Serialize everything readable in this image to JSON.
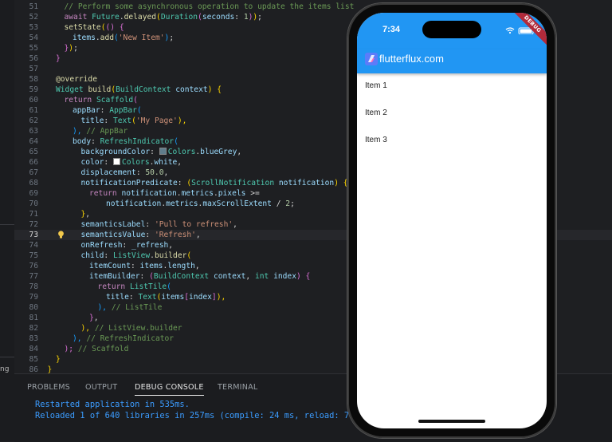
{
  "sidebar": {
    "fragment": "ng"
  },
  "editor": {
    "active_line": 73,
    "lines": [
      {
        "n": 51,
        "segs": [
          [
            "cm",
            "// Perform some asynchronous operation to update the items list"
          ]
        ],
        "indent": 10
      },
      {
        "n": 52,
        "segs": [
          [
            "kw",
            "await "
          ],
          [
            "ty",
            "Future"
          ],
          [
            "",
            "."
          ],
          [
            "fn",
            "delayed"
          ],
          [
            "br",
            "("
          ],
          [
            "ty",
            "Duration"
          ],
          [
            "br2",
            "("
          ],
          [
            "prop",
            "seconds"
          ],
          [
            "",
            ": "
          ],
          [
            "num",
            "1"
          ],
          [
            "br2",
            ")"
          ],
          [
            "br",
            ")"
          ],
          [
            "",
            ";"
          ]
        ],
        "indent": 10
      },
      {
        "n": 53,
        "segs": [
          [
            "fn",
            "setState"
          ],
          [
            "br",
            "("
          ],
          [
            "br2",
            "("
          ],
          [
            "br2",
            ")"
          ],
          [
            "",
            " "
          ],
          [
            "br2",
            "{"
          ]
        ],
        "indent": 10
      },
      {
        "n": 54,
        "segs": [
          [
            "prop",
            "items"
          ],
          [
            "",
            "."
          ],
          [
            "fn",
            "add"
          ],
          [
            "br3",
            "("
          ],
          [
            "str",
            "'New Item'"
          ],
          [
            "br3",
            ")"
          ],
          [
            "",
            ";"
          ]
        ],
        "indent": 20
      },
      {
        "n": 55,
        "segs": [
          [
            "br2",
            "}"
          ],
          [
            "br",
            ")"
          ],
          [
            "",
            ";"
          ]
        ],
        "indent": 10
      },
      {
        "n": 56,
        "segs": [
          [
            "br2",
            "}"
          ]
        ],
        "indent": 0
      },
      {
        "n": 57,
        "segs": [],
        "indent": 0
      },
      {
        "n": 58,
        "segs": [
          [
            "an",
            "@override"
          ]
        ],
        "indent": 0
      },
      {
        "n": 59,
        "segs": [
          [
            "ty",
            "Widget "
          ],
          [
            "fn",
            "build"
          ],
          [
            "br",
            "("
          ],
          [
            "ty",
            "BuildContext "
          ],
          [
            "prop",
            "context"
          ],
          [
            "br",
            ")"
          ],
          [
            "",
            " "
          ],
          [
            "br",
            "{"
          ]
        ],
        "indent": 0
      },
      {
        "n": 60,
        "segs": [
          [
            "kw",
            "return "
          ],
          [
            "ty",
            "Scaffold"
          ],
          [
            "br2",
            "("
          ]
        ],
        "indent": 10
      },
      {
        "n": 61,
        "segs": [
          [
            "prop",
            "appBar"
          ],
          [
            "",
            ": "
          ],
          [
            "ty",
            "AppBar"
          ],
          [
            "br3",
            "("
          ]
        ],
        "indent": 20
      },
      {
        "n": 62,
        "segs": [
          [
            "prop",
            "title"
          ],
          [
            "",
            ": "
          ],
          [
            "ty",
            "Text"
          ],
          [
            "br",
            "("
          ],
          [
            "str",
            "'My Page'"
          ],
          [
            "br",
            "),"
          ]
        ],
        "indent": 30
      },
      {
        "n": 63,
        "segs": [
          [
            "br3",
            "), "
          ],
          [
            "cm",
            "// AppBar"
          ]
        ],
        "indent": 20
      },
      {
        "n": 64,
        "segs": [
          [
            "prop",
            "body"
          ],
          [
            "",
            ": "
          ],
          [
            "ty",
            "RefreshIndicator"
          ],
          [
            "br3",
            "("
          ]
        ],
        "indent": 20
      },
      {
        "n": 65,
        "segs": [
          [
            "prop",
            "backgroundColor"
          ],
          [
            "",
            ": "
          ],
          [
            "sw1",
            ""
          ],
          [
            "ty",
            "Colors"
          ],
          [
            "",
            "."
          ],
          [
            "prop",
            "blueGrey"
          ],
          [
            "",
            ","
          ]
        ],
        "indent": 30
      },
      {
        "n": 66,
        "segs": [
          [
            "prop",
            "color"
          ],
          [
            "",
            ": "
          ],
          [
            "sw2",
            ""
          ],
          [
            "ty",
            "Colors"
          ],
          [
            "",
            "."
          ],
          [
            "prop",
            "white"
          ],
          [
            "",
            ","
          ]
        ],
        "indent": 30
      },
      {
        "n": 67,
        "segs": [
          [
            "prop",
            "displacement"
          ],
          [
            "",
            ": "
          ],
          [
            "num",
            "50.0"
          ],
          [
            "",
            ","
          ]
        ],
        "indent": 30
      },
      {
        "n": 68,
        "segs": [
          [
            "prop",
            "notificationPredicate"
          ],
          [
            "",
            ": "
          ],
          [
            "br",
            "("
          ],
          [
            "ty",
            "ScrollNotification "
          ],
          [
            "prop",
            "notification"
          ],
          [
            "br",
            ")"
          ],
          [
            "",
            " "
          ],
          [
            "br",
            "{"
          ]
        ],
        "indent": 30
      },
      {
        "n": 69,
        "segs": [
          [
            "kw",
            "return "
          ],
          [
            "prop",
            "notification"
          ],
          [
            "",
            "."
          ],
          [
            "prop",
            "metrics"
          ],
          [
            "",
            "."
          ],
          [
            "prop",
            "pixels "
          ],
          [
            "",
            ">="
          ]
        ],
        "indent": 40
      },
      {
        "n": 70,
        "segs": [
          [
            "prop",
            "notification"
          ],
          [
            "",
            "."
          ],
          [
            "prop",
            "metrics"
          ],
          [
            "",
            "."
          ],
          [
            "prop",
            "maxScrollExtent"
          ],
          [
            "",
            " / "
          ],
          [
            "num",
            "2"
          ],
          [
            "",
            ";"
          ]
        ],
        "indent": 60
      },
      {
        "n": 71,
        "segs": [
          [
            "br",
            "}"
          ],
          [
            "",
            ","
          ]
        ],
        "indent": 30
      },
      {
        "n": 72,
        "segs": [
          [
            "prop",
            "semanticsLabel"
          ],
          [
            "",
            ": "
          ],
          [
            "str",
            "'Pull to refresh'"
          ],
          [
            "",
            ","
          ]
        ],
        "indent": 30
      },
      {
        "n": 73,
        "segs": [
          [
            "prop",
            "semanticsValue"
          ],
          [
            "",
            ": "
          ],
          [
            "str",
            "'Refresh'"
          ],
          [
            "",
            ","
          ]
        ],
        "indent": 30
      },
      {
        "n": 74,
        "segs": [
          [
            "prop",
            "onRefresh"
          ],
          [
            "",
            ": "
          ],
          [
            "prop",
            "_refresh"
          ],
          [
            "",
            ","
          ]
        ],
        "indent": 30
      },
      {
        "n": 75,
        "segs": [
          [
            "prop",
            "child"
          ],
          [
            "",
            ": "
          ],
          [
            "ty",
            "ListView"
          ],
          [
            "",
            "."
          ],
          [
            "fn",
            "builder"
          ],
          [
            "br",
            "("
          ]
        ],
        "indent": 30
      },
      {
        "n": 76,
        "segs": [
          [
            "prop",
            "itemCount"
          ],
          [
            "",
            ": "
          ],
          [
            "prop",
            "items"
          ],
          [
            "",
            "."
          ],
          [
            "prop",
            "length"
          ],
          [
            "",
            ","
          ]
        ],
        "indent": 40
      },
      {
        "n": 77,
        "segs": [
          [
            "prop",
            "itemBuilder"
          ],
          [
            "",
            ": "
          ],
          [
            "br2",
            "("
          ],
          [
            "ty",
            "BuildContext "
          ],
          [
            "prop",
            "context"
          ],
          [
            "",
            ", "
          ],
          [
            "ty",
            "int "
          ],
          [
            "prop",
            "index"
          ],
          [
            "br2",
            ")"
          ],
          [
            "",
            " "
          ],
          [
            "br2",
            "{"
          ]
        ],
        "indent": 40
      },
      {
        "n": 78,
        "segs": [
          [
            "kw",
            "return "
          ],
          [
            "ty",
            "ListTile"
          ],
          [
            "br3",
            "("
          ]
        ],
        "indent": 50
      },
      {
        "n": 79,
        "segs": [
          [
            "prop",
            "title"
          ],
          [
            "",
            ": "
          ],
          [
            "ty",
            "Text"
          ],
          [
            "br",
            "("
          ],
          [
            "prop",
            "items"
          ],
          [
            "br2",
            "["
          ],
          [
            "prop",
            "index"
          ],
          [
            "br2",
            "]"
          ],
          [
            "br",
            "),"
          ]
        ],
        "indent": 60
      },
      {
        "n": 80,
        "segs": [
          [
            "br3",
            "), "
          ],
          [
            "cm",
            "// ListTile"
          ]
        ],
        "indent": 50
      },
      {
        "n": 81,
        "segs": [
          [
            "br2",
            "}"
          ],
          [
            "",
            ","
          ]
        ],
        "indent": 40
      },
      {
        "n": 82,
        "segs": [
          [
            "br",
            "), "
          ],
          [
            "cm",
            "// ListView.builder"
          ]
        ],
        "indent": 30
      },
      {
        "n": 83,
        "segs": [
          [
            "br3",
            "), "
          ],
          [
            "cm",
            "// RefreshIndicator"
          ]
        ],
        "indent": 20
      },
      {
        "n": 84,
        "segs": [
          [
            "br2",
            "); "
          ],
          [
            "cm",
            "// Scaffold"
          ]
        ],
        "indent": 10
      },
      {
        "n": 85,
        "segs": [
          [
            "br",
            "}"
          ]
        ],
        "indent": 0
      },
      {
        "n": 86,
        "segs": [
          [
            "br",
            "}"
          ]
        ],
        "indent": -10
      }
    ]
  },
  "panel": {
    "tabs": [
      "PROBLEMS",
      "OUTPUT",
      "DEBUG CONSOLE",
      "TERMINAL"
    ],
    "active_tab": "DEBUG CONSOLE",
    "console": [
      "Restarted application in 535ms.",
      "Reloaded 1 of 640 libraries in 257ms (compile: 24 ms, reload: 7"
    ]
  },
  "phone": {
    "time": "7:34",
    "debug_label": "DEBUG",
    "app_title": "flutterflux.com",
    "items": [
      "Item 1",
      "Item 2",
      "Item 3"
    ],
    "colors": {
      "appbar": "#2196f3",
      "debug_banner": "#b12a3a",
      "swatch_bluegrey": "#607d8b",
      "swatch_white": "#ffffff"
    }
  }
}
